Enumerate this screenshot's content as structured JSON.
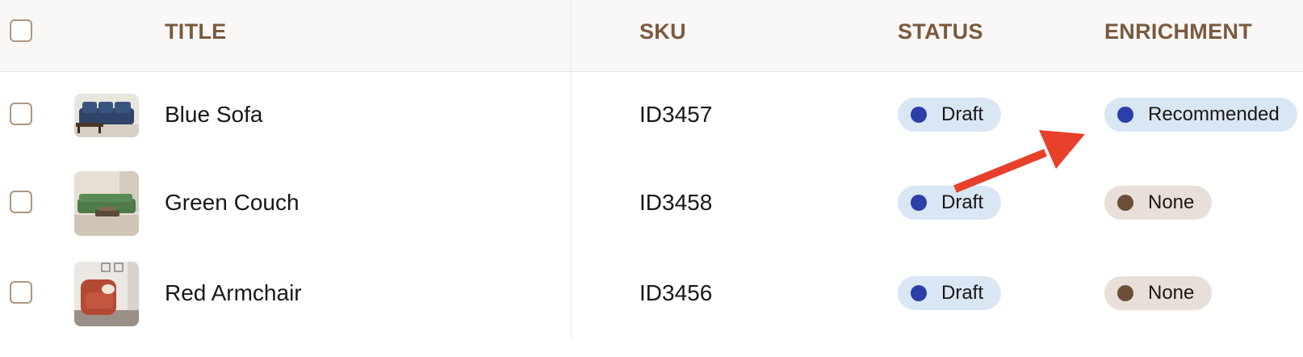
{
  "header": {
    "title_label": "TITLE",
    "sku_label": "SKU",
    "status_label": "STATUS",
    "enrichment_label": "ENRICHMENT"
  },
  "rows": [
    {
      "title": "Blue Sofa",
      "sku": "ID3457",
      "status": "Draft",
      "enrichment": "Recommended",
      "thumbnail": "blue-sofa-photo"
    },
    {
      "title": "Green Couch",
      "sku": "ID3458",
      "status": "Draft",
      "enrichment": "None",
      "thumbnail": "green-couch-photo"
    },
    {
      "title": "Red Armchair",
      "sku": "ID3456",
      "status": "Draft",
      "enrichment": "None",
      "thumbnail": "red-armchair-photo"
    }
  ],
  "colors": {
    "header_text": "#7a5a3e",
    "draft_dot": "#2a3fa8",
    "recommended_dot": "#2a3fa8",
    "none_dot": "#6b4f36",
    "annotation_arrow": "#e8402a"
  }
}
